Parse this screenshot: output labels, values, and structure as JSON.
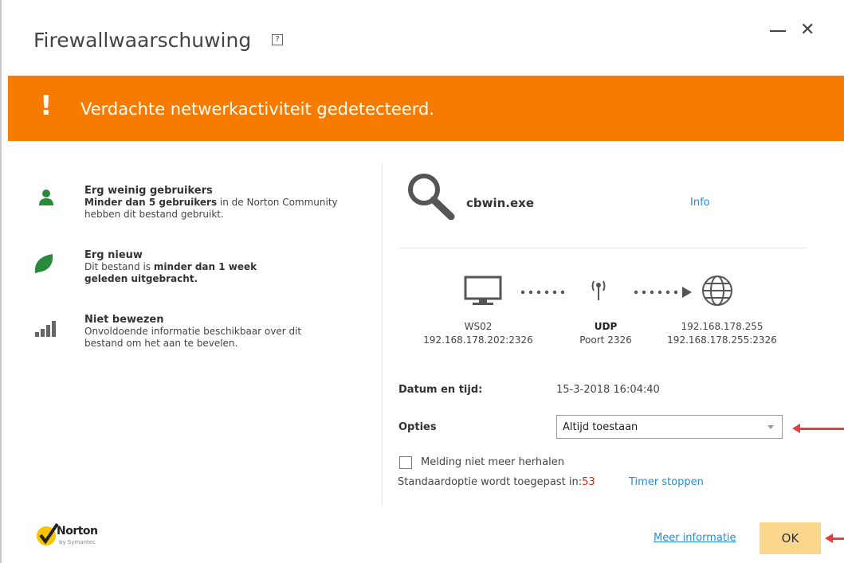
{
  "window": {
    "title": "Firewallwaarschuwing",
    "help_label": "?",
    "close_label": "✕"
  },
  "banner": {
    "icon": "!",
    "message": "Verdachte netwerkactiviteit gedetecteerd.",
    "color": "#f67b00"
  },
  "details": {
    "users": {
      "heading": "Erg weinig gebruikers",
      "bold": "Minder dan 5 gebruikers",
      "rest_line1": " in de Norton Community",
      "line2": "hebben dit bestand gebruikt."
    },
    "age": {
      "heading": "Erg nieuw",
      "line1_prefix": "Dit bestand is ",
      "line1_bold": "minder dan 1 week",
      "line2_bold": "geleden uitgebracht."
    },
    "proof": {
      "heading": "Niet bewezen",
      "line1": "Onvoldoende informatie beschikbaar over dit",
      "line2": "bestand om het aan te bevelen."
    }
  },
  "file": {
    "name": "cbwin.exe",
    "info_link": "Info"
  },
  "connection": {
    "source_name": "WS02",
    "source_addr": "192.168.178.202:2326",
    "protocol": "UDP",
    "port": "Poort 2326",
    "dest_name": "192.168.178.255",
    "dest_addr": "192.168.178.255:2326"
  },
  "date": {
    "label": "Datum en tijd:",
    "value": "15-3-2018 16:04:40"
  },
  "options": {
    "label": "Opties",
    "selected": "Altijd toestaan"
  },
  "reminder": {
    "checkbox_label": "Melding niet meer herhalen",
    "default_text": "Standaardoptie wordt toegepast in:",
    "countdown": "53",
    "timer_link": "Timer stoppen"
  },
  "footer": {
    "logo_text": "Norton",
    "logo_sub": "by Symantec",
    "more_link": "Meer informatie",
    "ok_label": "OK"
  },
  "colors": {
    "accent": "#f67b00",
    "link": "#2b8ad8",
    "ok_button": "#fbd78e",
    "annotation_arrow": "#e04040",
    "green_icon": "#2a8a3c"
  }
}
